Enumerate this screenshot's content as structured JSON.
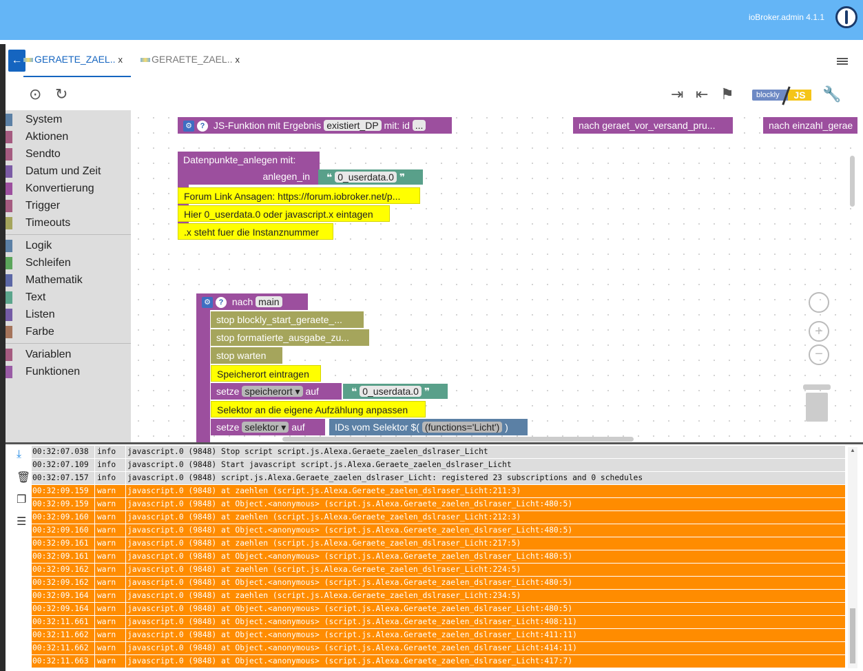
{
  "header": {
    "title": "ioBroker.admin 4.1.1"
  },
  "tabs": [
    {
      "label": "GERAETE_ZAEL..",
      "close": "x"
    },
    {
      "label": "GERAETE_ZAEL..",
      "close": "x"
    }
  ],
  "toolbar": {
    "blockly_label": "blockly",
    "js_label": "JS"
  },
  "categories": {
    "group1": [
      "System",
      "Aktionen",
      "Sendto",
      "Datum und Zeit",
      "Konvertierung",
      "Trigger",
      "Timeouts"
    ],
    "group2": [
      "Logik",
      "Schleifen",
      "Mathematik",
      "Text",
      "Listen",
      "Farbe"
    ],
    "group3": [
      "Variablen",
      "Funktionen"
    ],
    "colors": {
      "group1": [
        "#5b80a5",
        "#a55b80",
        "#a55b80",
        "#7b5ba5",
        "#9c4f9e",
        "#a55b80",
        "#a5a55c"
      ],
      "group2": [
        "#5b80a5",
        "#5ba55b",
        "#5b67a5",
        "#5ba58c",
        "#745ba5",
        "#a5745b"
      ],
      "group3": [
        "#a55b80",
        "#995ba5"
      ]
    }
  },
  "blocks": {
    "func_def": {
      "text": "JS-Funktion mit Ergebnis",
      "name": "existiert_DP",
      "with": "mit: id",
      "more": "..."
    },
    "call1": "nach geraet_vor_versand_pru...",
    "call2": "nach einzahl_gerae",
    "datenpunkte": {
      "title": "Datenpunkte_anlegen  mit:",
      "param": "anlegen_in",
      "value": "0_userdata.0"
    },
    "comments": [
      "Forum Link Ansagen: https://forum.iobroker.net/p...",
      "Hier 0_userdata.0 oder javascript.x eintagen",
      ".x steht fuer die Instanznummer"
    ],
    "main": {
      "prefix": "nach",
      "name": "main"
    },
    "stop1": "stop blockly_start_geraete_...",
    "stop2": "stop formatierte_ausgabe_zu...",
    "stop3": "stop warten",
    "comment_speicher": "Speicherort eintragen",
    "setze1": {
      "setze": "setze",
      "var": "speicherort",
      "auf": "auf",
      "value": "0_userdata.0"
    },
    "comment_selektor": "Selektor an die eigene Aufzählung anpassen",
    "setze2": {
      "setze": "setze",
      "var": "selektor",
      "auf": "auf",
      "ids": "IDs vom Selektor $(",
      "sel": "(functions='Licht')",
      "close": ")"
    }
  },
  "log": [
    {
      "time": "00:32:07.038",
      "sev": "info",
      "msg": "javascript.0 (9848) Stop script script.js.Alexa.Geraete_zaelen_dslraser_Licht"
    },
    {
      "time": "00:32:07.109",
      "sev": "info",
      "msg": "javascript.0 (9848) Start javascript script.js.Alexa.Geraete_zaelen_dslraser_Licht"
    },
    {
      "time": "00:32:07.157",
      "sev": "info",
      "msg": "javascript.0 (9848) script.js.Alexa.Geraete_zaelen_dslraser_Licht: registered 23 subscriptions and 0 schedules"
    },
    {
      "time": "00:32:09.159",
      "sev": "warn",
      "msg": "javascript.0 (9848) at zaehlen (script.js.Alexa.Geraete_zaelen_dslraser_Licht:211:3)"
    },
    {
      "time": "00:32:09.159",
      "sev": "warn",
      "msg": "javascript.0 (9848) at Object.<anonymous> (script.js.Alexa.Geraete_zaelen_dslraser_Licht:480:5)"
    },
    {
      "time": "00:32:09.160",
      "sev": "warn",
      "msg": "javascript.0 (9848) at zaehlen (script.js.Alexa.Geraete_zaelen_dslraser_Licht:212:3)"
    },
    {
      "time": "00:32:09.160",
      "sev": "warn",
      "msg": "javascript.0 (9848) at Object.<anonymous> (script.js.Alexa.Geraete_zaelen_dslraser_Licht:480:5)"
    },
    {
      "time": "00:32:09.161",
      "sev": "warn",
      "msg": "javascript.0 (9848) at zaehlen (script.js.Alexa.Geraete_zaelen_dslraser_Licht:217:5)"
    },
    {
      "time": "00:32:09.161",
      "sev": "warn",
      "msg": "javascript.0 (9848) at Object.<anonymous> (script.js.Alexa.Geraete_zaelen_dslraser_Licht:480:5)"
    },
    {
      "time": "00:32:09.162",
      "sev": "warn",
      "msg": "javascript.0 (9848) at zaehlen (script.js.Alexa.Geraete_zaelen_dslraser_Licht:224:5)"
    },
    {
      "time": "00:32:09.162",
      "sev": "warn",
      "msg": "javascript.0 (9848) at Object.<anonymous> (script.js.Alexa.Geraete_zaelen_dslraser_Licht:480:5)"
    },
    {
      "time": "00:32:09.164",
      "sev": "warn",
      "msg": "javascript.0 (9848) at zaehlen (script.js.Alexa.Geraete_zaelen_dslraser_Licht:234:5)"
    },
    {
      "time": "00:32:09.164",
      "sev": "warn",
      "msg": "javascript.0 (9848) at Object.<anonymous> (script.js.Alexa.Geraete_zaelen_dslraser_Licht:480:5)"
    },
    {
      "time": "00:32:11.661",
      "sev": "warn",
      "msg": "javascript.0 (9848) at Object.<anonymous> (script.js.Alexa.Geraete_zaelen_dslraser_Licht:408:11)"
    },
    {
      "time": "00:32:11.662",
      "sev": "warn",
      "msg": "javascript.0 (9848) at Object.<anonymous> (script.js.Alexa.Geraete_zaelen_dslraser_Licht:411:11)"
    },
    {
      "time": "00:32:11.662",
      "sev": "warn",
      "msg": "javascript.0 (9848) at Object.<anonymous> (script.js.Alexa.Geraete_zaelen_dslraser_Licht:414:11)"
    },
    {
      "time": "00:32:11.663",
      "sev": "warn",
      "msg": "javascript.0 (9848) at Object.<anonymous> (script.js.Alexa.Geraete_zaelen_dslraser_Licht:417:7)"
    }
  ]
}
